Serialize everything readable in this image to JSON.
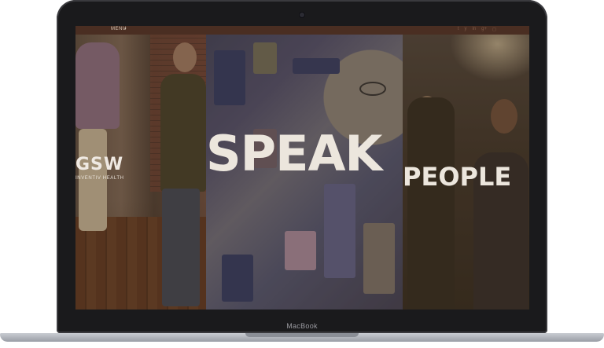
{
  "device": {
    "brand_label": "MacBook"
  },
  "site": {
    "menu_label": "MENU",
    "menu_caret": "▾",
    "socials": [
      "t",
      "y",
      "in",
      "g+",
      "◻"
    ]
  },
  "logo": {
    "mark": "GSW",
    "sub": "INVENTIV HEALTH"
  },
  "hero": {
    "word_main": "SPEAK",
    "word_secondary": "PEOPLE"
  },
  "colors": {
    "navbar": "#4a2e22",
    "text_light": "#ece6dd"
  }
}
